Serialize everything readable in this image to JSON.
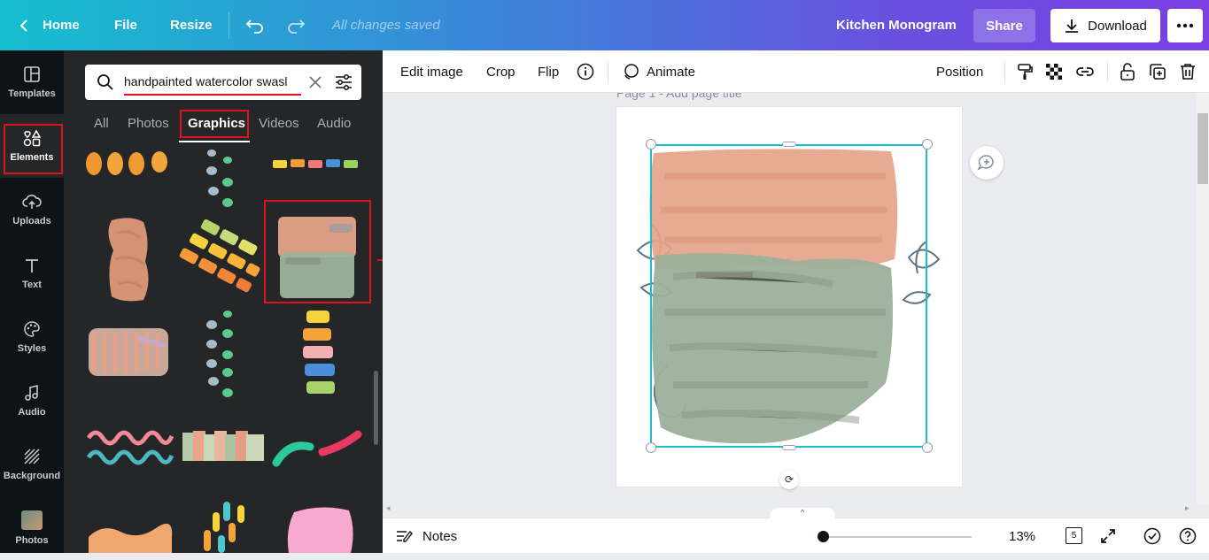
{
  "topbar": {
    "home_label": "Home",
    "file_label": "File",
    "resize_label": "Resize",
    "saved_status": "All changes saved",
    "design_title": "Kitchen Monogram",
    "share_label": "Share",
    "download_label": "Download"
  },
  "rail": {
    "items": [
      {
        "label": "Templates",
        "icon": "templates-icon"
      },
      {
        "label": "Elements",
        "icon": "elements-icon",
        "active": true
      },
      {
        "label": "Uploads",
        "icon": "upload-cloud-icon"
      },
      {
        "label": "Text",
        "icon": "text-icon"
      },
      {
        "label": "Styles",
        "icon": "palette-icon"
      },
      {
        "label": "Audio",
        "icon": "music-note-icon"
      },
      {
        "label": "Background",
        "icon": "background-hatch-icon"
      },
      {
        "label": "Photos",
        "icon": "photos-icon"
      }
    ]
  },
  "panel": {
    "search_value": "handpainted watercolor swasl",
    "tabs": [
      "All",
      "Photos",
      "Graphics",
      "Videos",
      "Audio"
    ],
    "active_tab": "Graphics"
  },
  "context_toolbar": {
    "edit_image_label": "Edit image",
    "crop_label": "Crop",
    "flip_label": "Flip",
    "animate_label": "Animate",
    "position_label": "Position"
  },
  "canvas": {
    "page_title_text": "Page 1 - Add page title"
  },
  "bottombar": {
    "notes_label": "Notes",
    "zoom_value": "13%",
    "page_count": "5",
    "zoom_fraction": 0.0
  },
  "colors": {
    "accent_cyan": "#14bfcf",
    "brand_purple": "#7a3fe2",
    "highlight_red": "#e0121f",
    "rail_bg": "#0e1318",
    "panel_bg": "#252627"
  }
}
